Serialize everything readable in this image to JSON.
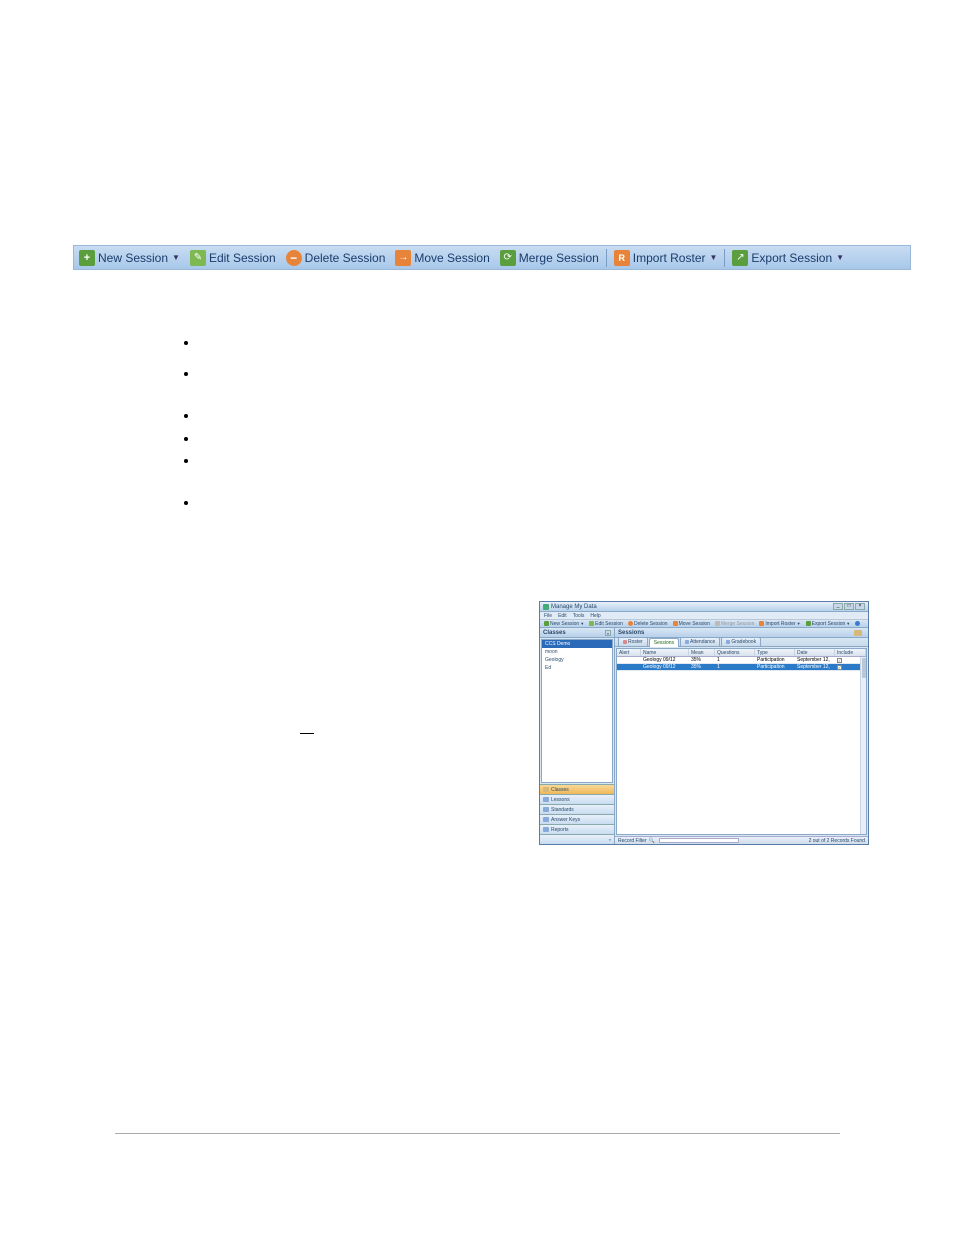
{
  "toolbar": {
    "new_session": "New Session",
    "edit_session": "Edit Session",
    "delete_session": "Delete Session",
    "move_session": "Move Session",
    "merge_session": "Merge Session",
    "import_roster": "Import Roster",
    "export_session": "Export Session"
  },
  "app": {
    "title": "Manage My Data",
    "menu": {
      "file": "File",
      "edit": "Edit",
      "tools": "Tools",
      "help": "Help"
    },
    "small_toolbar": {
      "new_session": "New Session",
      "edit_session": "Edit Session",
      "delete_session": "Delete Session",
      "move_session": "Move Session",
      "merge_session": "Merge Session",
      "import_roster": "Import Roster",
      "export_session": "Export Session"
    },
    "left": {
      "header": "Classes",
      "classes": [
        "CCS Demo",
        "moon",
        "Geology",
        "Ed"
      ],
      "nav": [
        "Classes",
        "Lessons",
        "Standards",
        "Answer Keys",
        "Reports"
      ]
    },
    "right": {
      "header": "Sessions",
      "tabs": [
        "Roster",
        "Sessions",
        "Attendance",
        "Gradebook"
      ],
      "columns": [
        "Alert",
        "Name",
        "Mean",
        "Questions",
        "Type",
        "Date",
        "Include"
      ],
      "rows": [
        {
          "name": "Geology 09/12",
          "mean": "35%",
          "questions": "1",
          "type": "Participation",
          "date": "September 12,",
          "include": true
        },
        {
          "name": "Geology 09/12",
          "mean": "35%",
          "questions": "1",
          "type": "Participation",
          "date": "September 12,",
          "include": true
        }
      ]
    },
    "status": {
      "filter_label": "Record Filter",
      "count": "2 out of 2 Records Found"
    }
  }
}
